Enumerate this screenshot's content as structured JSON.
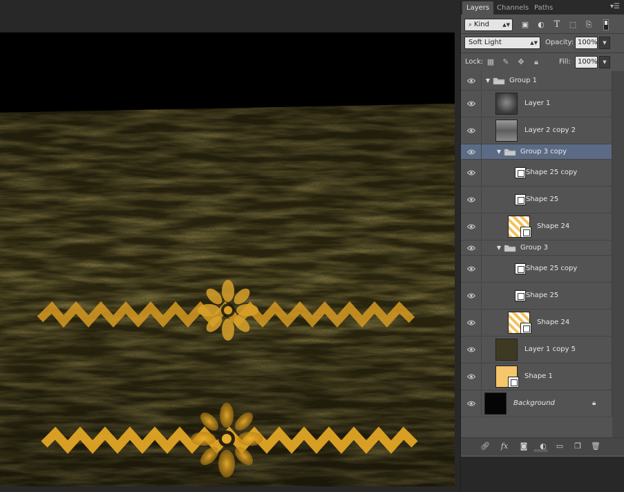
{
  "panel": {
    "tabs": [
      {
        "label": "Layers",
        "active": true
      },
      {
        "label": "Channels",
        "active": false
      },
      {
        "label": "Paths",
        "active": false
      }
    ],
    "menu_icon": "panel-menu-icon",
    "filter": {
      "kind_label": "Kind",
      "search_icon": "search-icon"
    },
    "filter_icons": [
      "pixel-filter-icon",
      "adjustment-filter-icon",
      "type-filter-icon",
      "shape-filter-icon",
      "smart-object-filter-icon",
      "filter-toggle-icon"
    ],
    "blend_mode": "Soft Light",
    "opacity_label": "Opacity:",
    "opacity_value": "100%",
    "lock_label": "Lock:",
    "lock_icons": [
      "lock-transparent-icon",
      "lock-image-icon",
      "lock-position-icon",
      "lock-all-icon"
    ],
    "fill_label": "Fill:",
    "fill_value": "100%",
    "bottom_icons": [
      "link-layers-icon",
      "fx-icon",
      "add-mask-icon",
      "adjustment-layer-icon",
      "new-group-icon",
      "new-layer-icon",
      "delete-layer-icon"
    ]
  },
  "layers": [
    {
      "name": "Group 1",
      "type": "group",
      "indent": 0,
      "expanded": true
    },
    {
      "name": "Layer 1",
      "type": "pixel",
      "indent": 1,
      "thumb": "grunge-dark"
    },
    {
      "name": "Layer 2 copy 2",
      "type": "pixel",
      "indent": 1,
      "thumb": "grunge-gray"
    },
    {
      "name": "Group 3 copy",
      "type": "group",
      "indent": 1,
      "expanded": true,
      "selected": true
    },
    {
      "name": "Shape 25 copy",
      "type": "shape",
      "indent": 2
    },
    {
      "name": "Shape 25",
      "type": "shape",
      "indent": 2
    },
    {
      "name": "Shape 24",
      "type": "shape-pattern",
      "indent": 2
    },
    {
      "name": "Group 3",
      "type": "group",
      "indent": 1,
      "expanded": true
    },
    {
      "name": "Shape 25 copy",
      "type": "shape",
      "indent": 2
    },
    {
      "name": "Shape 25",
      "type": "shape",
      "indent": 2
    },
    {
      "name": "Shape 24",
      "type": "shape-pattern",
      "indent": 2
    },
    {
      "name": "Layer 1 copy 5",
      "type": "pixel",
      "indent": 1,
      "thumb": "olive-texture"
    },
    {
      "name": "Shape 1",
      "type": "shape-yellow",
      "indent": 1
    },
    {
      "name": "Background",
      "type": "background",
      "indent": 0,
      "locked": true,
      "italic": true
    }
  ],
  "colors": {
    "accent": "#e0a82a",
    "selected_row": "#5b6b85",
    "canvas_texture": "#2b2612"
  }
}
